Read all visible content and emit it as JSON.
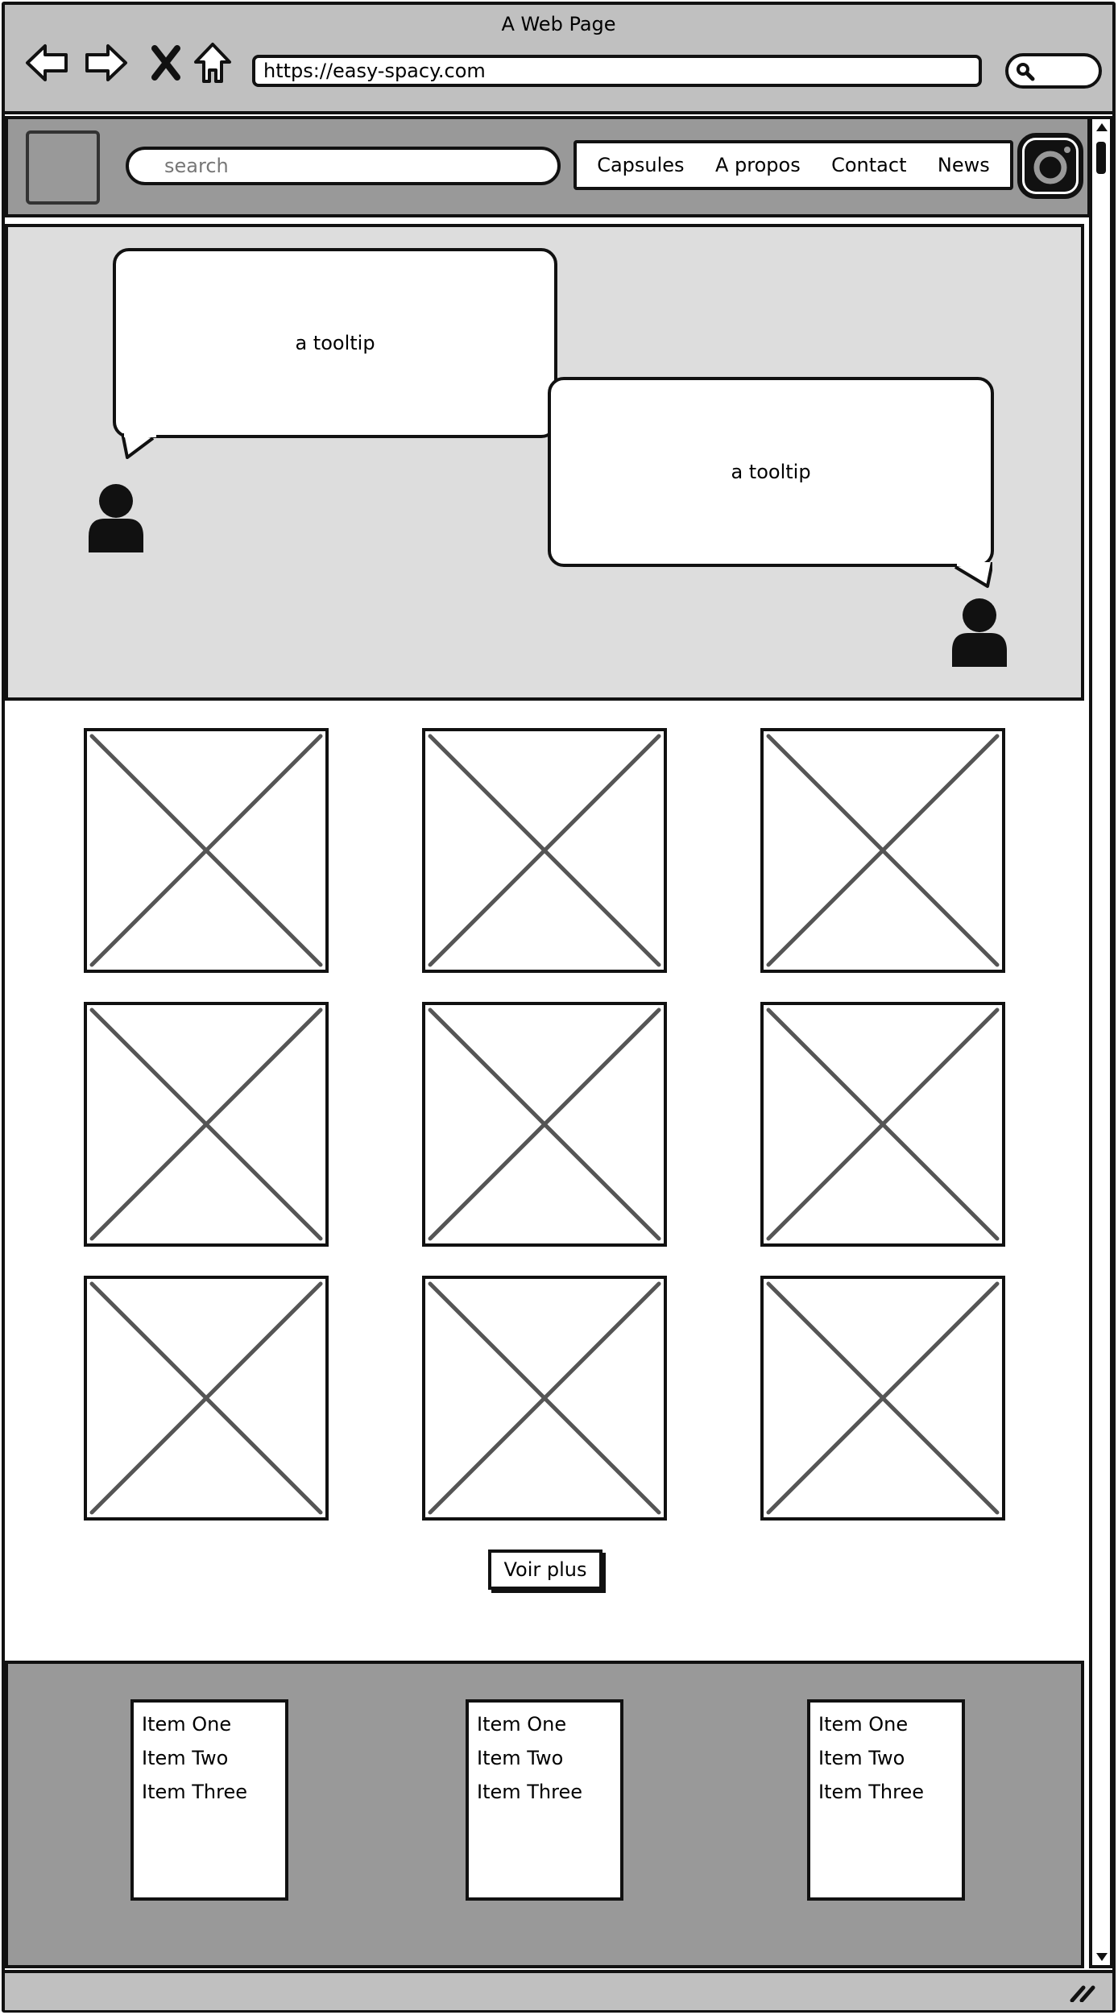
{
  "window": {
    "title": "A Web Page"
  },
  "browser": {
    "url": "https://easy-spacy.com"
  },
  "header": {
    "search_placeholder": "search",
    "nav": [
      "Capsules",
      "A propos",
      "Contact",
      "News"
    ],
    "social_icon": "instagram-icon"
  },
  "hero": {
    "tooltip_1": "a tooltip",
    "tooltip_2": "a tooltip"
  },
  "gallery": {
    "rows": 3,
    "columns": 3
  },
  "main": {
    "more_button": "Voir plus"
  },
  "footer": {
    "lists": [
      [
        "Item One",
        "Item Two",
        "Item Three"
      ],
      [
        "Item One",
        "Item Two",
        "Item Three"
      ],
      [
        "Item One",
        "Item Two",
        "Item Three"
      ]
    ]
  },
  "colors": {
    "titlebar": "#c0c0c0",
    "header": "#999999",
    "hero": "#dddddd",
    "footer": "#999999"
  }
}
